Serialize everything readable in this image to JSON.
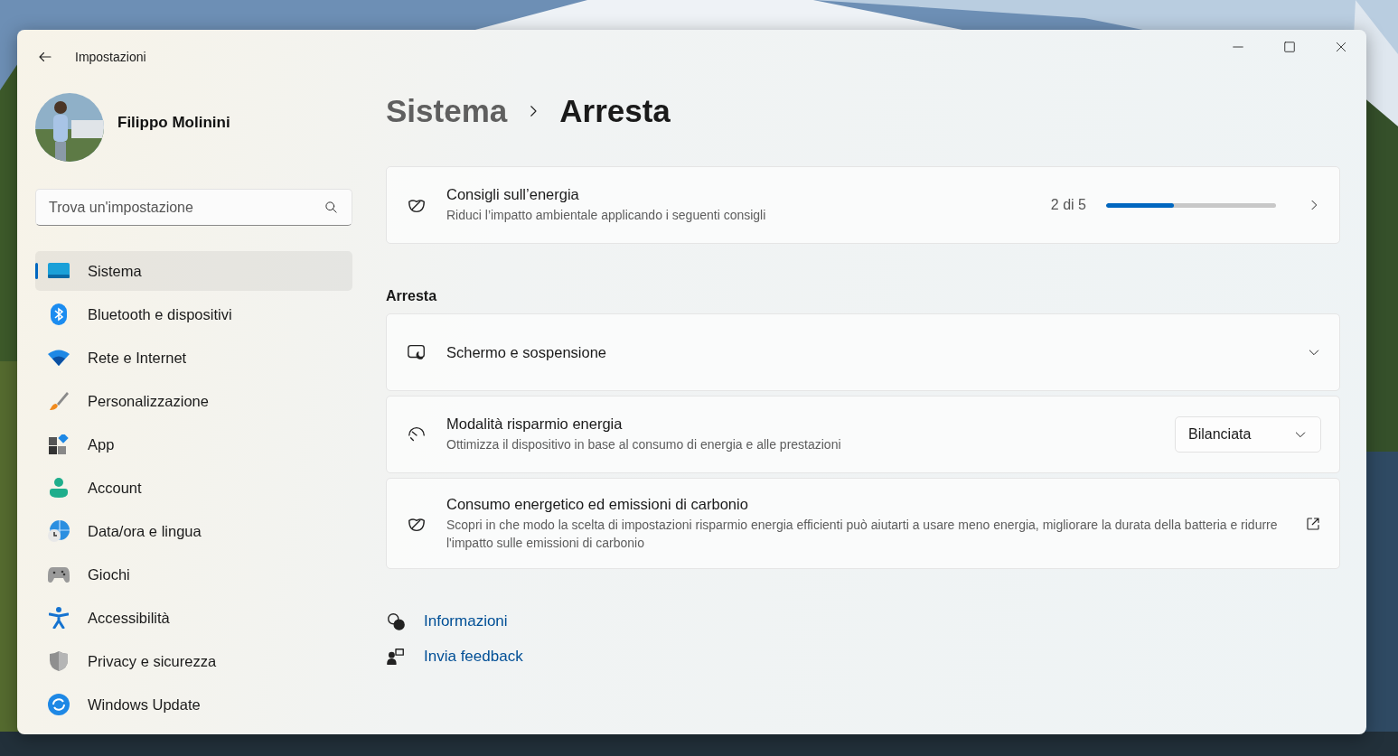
{
  "window": {
    "title": "Impostazioni"
  },
  "profile": {
    "name": "Filippo Molinini"
  },
  "search": {
    "placeholder": "Trova un'impostazione"
  },
  "sidebar": {
    "items": [
      {
        "label": "Sistema",
        "selected": true
      },
      {
        "label": "Bluetooth e dispositivi",
        "selected": false
      },
      {
        "label": "Rete e Internet",
        "selected": false
      },
      {
        "label": "Personalizzazione",
        "selected": false
      },
      {
        "label": "App",
        "selected": false
      },
      {
        "label": "Account",
        "selected": false
      },
      {
        "label": "Data/ora e lingua",
        "selected": false
      },
      {
        "label": "Giochi",
        "selected": false
      },
      {
        "label": "Accessibilità",
        "selected": false
      },
      {
        "label": "Privacy e sicurezza",
        "selected": false
      },
      {
        "label": "Windows Update",
        "selected": false
      }
    ]
  },
  "breadcrumb": [
    "Sistema",
    "Arresta"
  ],
  "recommendation": {
    "kind": "progress",
    "title": "Consigli sull’energia",
    "description": "Riduci l’impatto ambientale applicando i seguenti consigli",
    "count": "2 di 5",
    "level": 0.4
  },
  "section": {
    "title": "Arresta",
    "cards": [
      {
        "kind": "expander",
        "title": "Schermo e sospensione",
        "expanded": false
      },
      {
        "kind": "dropdown",
        "title": "Modalità risparmio energia",
        "description": "Ottimizza il dispositivo in base al consumo di energia e alle prestazioni",
        "value": "Bilanciata"
      },
      {
        "kind": "external",
        "title": "Consumo energetico ed emissioni di carbonio",
        "description": "Scopri in che modo la scelta di impostazioni risparmio energia efficienti può aiutarti a usare meno energia, migliorare la durata della batteria e ridurre l'impatto sulle emissioni di carbonio"
      }
    ]
  },
  "links": [
    "Informazioni",
    "Invia feedback"
  ]
}
